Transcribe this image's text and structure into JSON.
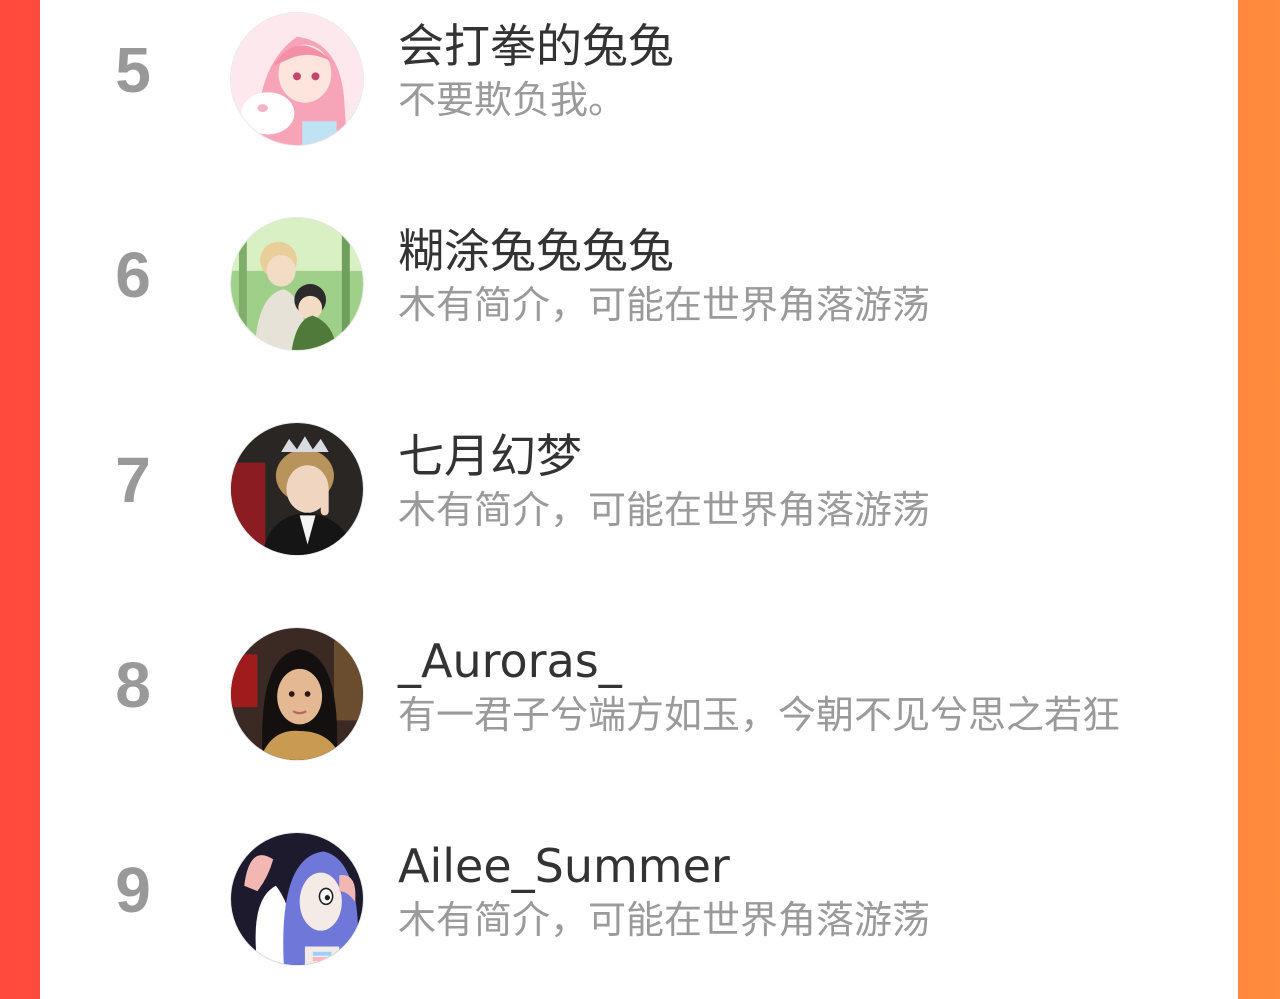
{
  "colors": {
    "background_gradient_start": "#ff4a3d",
    "background_gradient_end": "#ff8b3d",
    "panel": "#ffffff",
    "rank_text": "#999999",
    "name_text": "#333333",
    "bio_text": "#9a9a9a"
  },
  "ranking": {
    "items": [
      {
        "rank": "5",
        "name": "会打拳的兔兔",
        "bio": "不要欺负我。",
        "avatar_icon": "pink-hair-anime-girl-avatar"
      },
      {
        "rank": "6",
        "name": "糊涂兔兔兔兔",
        "bio": "木有简介，可能在世界角落游荡",
        "avatar_icon": "forest-anime-couple-avatar"
      },
      {
        "rank": "7",
        "name": "七月幻梦",
        "bio": "木有简介，可能在世界角落游荡",
        "avatar_icon": "crowned-boy-avatar"
      },
      {
        "rank": "8",
        "name": "_Auroras_",
        "bio": "有一君子兮端方如玉，今朝不见兮思之若狂",
        "avatar_icon": "girl-portrait-avatar"
      },
      {
        "rank": "9",
        "name": "Ailee_Summer",
        "bio": "木有简介，可能在世界角落游荡",
        "avatar_icon": "blue-hair-cartoon-avatar"
      }
    ]
  }
}
